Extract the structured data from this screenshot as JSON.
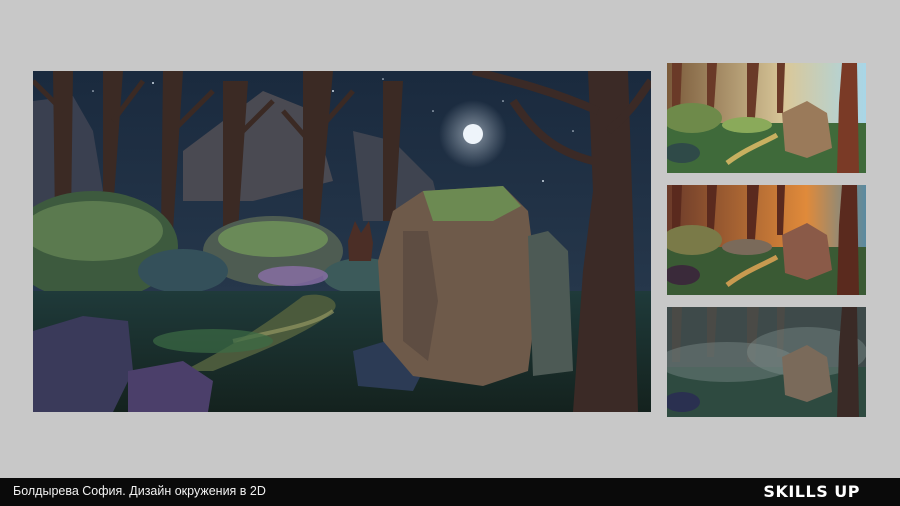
{
  "footer": {
    "caption": "Болдырева София. Дизайн окружения в 2D",
    "brand": "SKILLS UP"
  },
  "artworks": {
    "main": {
      "variant": "night-moonlit-forest"
    },
    "thumbnails": [
      {
        "variant": "day-sunlight"
      },
      {
        "variant": "sunset-orange"
      },
      {
        "variant": "foggy-morning"
      }
    ]
  },
  "colors": {
    "background": "#c8c8c8",
    "footer": "#0a0a0a",
    "footer_text": "#ffffff"
  }
}
